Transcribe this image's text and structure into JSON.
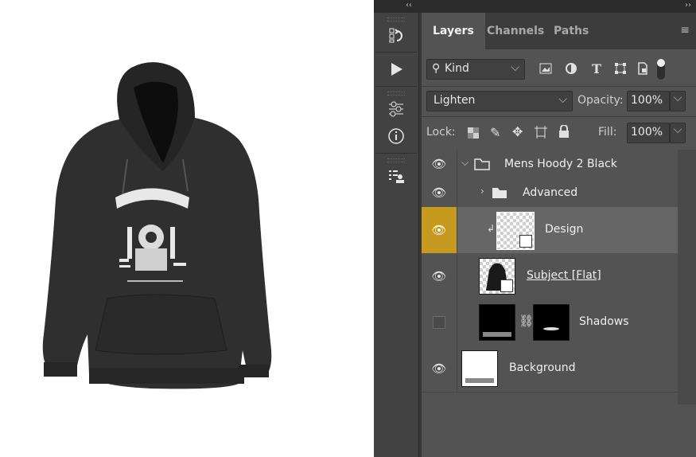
{
  "canvas": {
    "art_alt": "hoodie mockup with Motor Riders design"
  },
  "header_strip": {
    "collapse_left": "‹‹",
    "collapse_right": "››"
  },
  "tabs": {
    "layers": "Layers",
    "channels": "Channels",
    "paths": "Paths"
  },
  "filter": {
    "kind_label": "Kind"
  },
  "blend": {
    "mode": "Lighten",
    "opacity_label": "Opacity:",
    "opacity_value": "100%"
  },
  "lock": {
    "label": "Lock:",
    "fill_label": "Fill:",
    "fill_value": "100%"
  },
  "layers": [
    {
      "name": "Mens Hoody 2 Black",
      "visible": true,
      "type": "group",
      "expanded": true
    },
    {
      "name": "Advanced",
      "visible": true,
      "type": "group",
      "expanded": false
    },
    {
      "name": "Design",
      "visible": true,
      "type": "smart-object",
      "selected": true,
      "clipped": true
    },
    {
      "name": "Subject [Flat]",
      "visible": true,
      "type": "smart-object"
    },
    {
      "name": "Shadows",
      "visible": false,
      "type": "masked"
    },
    {
      "name": "Background",
      "visible": true,
      "type": "pixel"
    }
  ],
  "colors": {
    "highlight": "#c69a1e",
    "panel": "#535353",
    "selected": "#666666"
  }
}
